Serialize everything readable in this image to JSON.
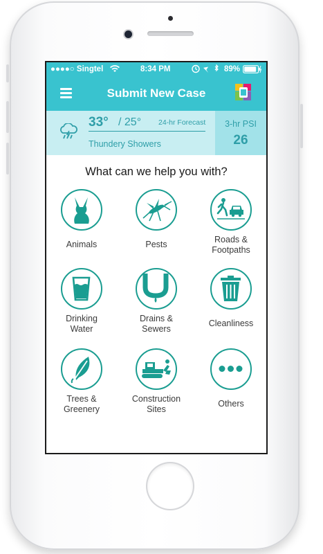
{
  "status_bar": {
    "carrier": "●●●●○ Singtel",
    "time": "8:34 PM",
    "battery": "89%"
  },
  "nav": {
    "title": "Submit New Case"
  },
  "weather": {
    "temp_high": "33°",
    "temp_low": "/ 25°",
    "forecast_label": "24-hr Forecast",
    "condition": "Thundery Showers",
    "psi_label": "3-hr PSI",
    "psi_value": "26"
  },
  "prompt": "What can we help you with?",
  "categories": [
    {
      "label": "Animals",
      "icon": "animal-icon"
    },
    {
      "label": "Pests",
      "icon": "mosquito-icon"
    },
    {
      "label": "Roads &\nFootpaths",
      "icon": "road-icon"
    },
    {
      "label": "Drinking\nWater",
      "icon": "water-glass-icon"
    },
    {
      "label": "Drains &\nSewers",
      "icon": "drain-icon"
    },
    {
      "label": "Cleanliness",
      "icon": "trash-bin-icon"
    },
    {
      "label": "Trees &\nGreenery",
      "icon": "leaf-icon"
    },
    {
      "label": "Construction\nSites",
      "icon": "bulldozer-icon"
    },
    {
      "label": "Others",
      "icon": "more-icon"
    }
  ],
  "colors": {
    "accent": "#39c3cf",
    "icon": "#1a9d91",
    "weather_bg": "#c8eef2",
    "psi_bg": "#a2e2e9"
  }
}
